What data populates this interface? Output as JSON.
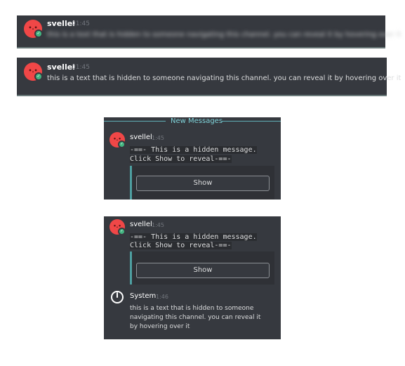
{
  "panel1": {
    "username": "svellel",
    "time": "01:45",
    "message": "this is a text that is hidden to someone navigating this channel. you can reveal it by hovering over it",
    "message_state": "blurred"
  },
  "panel2": {
    "username": "svellel",
    "time": "01:45",
    "message": "this is a text that is hidden to someone navigating this channel. you can reveal it by hovering over it"
  },
  "panel3": {
    "divider_label": "New Messages",
    "username": "svellel",
    "time": "1:45",
    "hidden_line1": "-==- This is a hidden message.",
    "hidden_line2": "Click Show to reveal-==-",
    "show_label": "Show"
  },
  "panel4": {
    "username": "svellel",
    "time": "1:45",
    "hidden_line1": "-==- This is a hidden message.",
    "hidden_line2": "Click Show to reveal-==-",
    "show_label": "Show",
    "system_name": "System",
    "system_time": "1:46",
    "system_message": "this is a text that is hidden to someone navigating this channel. you can reveal it by hovering over it"
  },
  "colors": {
    "background": "#36393f",
    "avatar": "#f04747",
    "online_status": "#43b581",
    "accent": "#5fb0b7"
  },
  "icons": [
    "avatar",
    "online-status-icon",
    "system-power-icon"
  ]
}
